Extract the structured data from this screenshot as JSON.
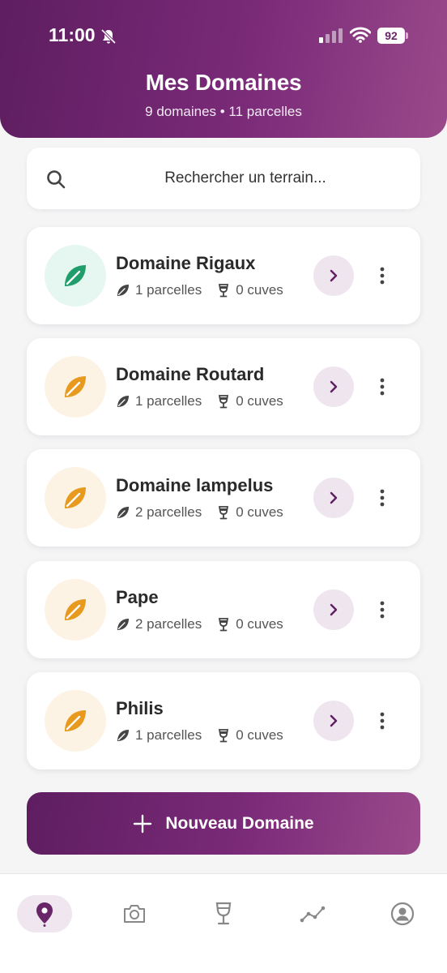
{
  "status_bar": {
    "time": "11:00",
    "battery": "92"
  },
  "header": {
    "title": "Mes Domaines",
    "subtitle": "9 domaines • 11 parcelles"
  },
  "search": {
    "placeholder": "Rechercher un terrain..."
  },
  "domains": [
    {
      "name": "Domaine Rigaux",
      "parcelles": "1 parcelles",
      "cuves": "0 cuves",
      "icon": "leaf-icon",
      "color": "#1f9d6a",
      "bg": "#e6f6f0"
    },
    {
      "name": "Domaine Routard",
      "parcelles": "1 parcelles",
      "cuves": "0 cuves",
      "icon": "leaf-icon",
      "color": "#e89a1f",
      "bg": "#fdf3e4"
    },
    {
      "name": "Domaine lampelus",
      "parcelles": "2 parcelles",
      "cuves": "0 cuves",
      "icon": "leaf-icon",
      "color": "#e89a1f",
      "bg": "#fdf3e4"
    },
    {
      "name": "Pape",
      "parcelles": "2 parcelles",
      "cuves": "0 cuves",
      "icon": "leaf-icon",
      "color": "#e89a1f",
      "bg": "#fdf3e4"
    },
    {
      "name": "Philis",
      "parcelles": "1 parcelles",
      "cuves": "0 cuves",
      "icon": "leaf-icon",
      "color": "#e89a1f",
      "bg": "#fdf3e4"
    }
  ],
  "actions": {
    "new_domain": "Nouveau Domaine"
  },
  "nav": [
    {
      "icon": "map-pin-icon",
      "active": true
    },
    {
      "icon": "camera-icon",
      "active": false
    },
    {
      "icon": "wine-glass-icon",
      "active": false
    },
    {
      "icon": "chart-line-icon",
      "active": false
    },
    {
      "icon": "profile-icon",
      "active": false
    }
  ],
  "colors": {
    "brand_start": "#5e1e60",
    "brand_end": "#9a4a8a",
    "accent": "#6a2468"
  }
}
